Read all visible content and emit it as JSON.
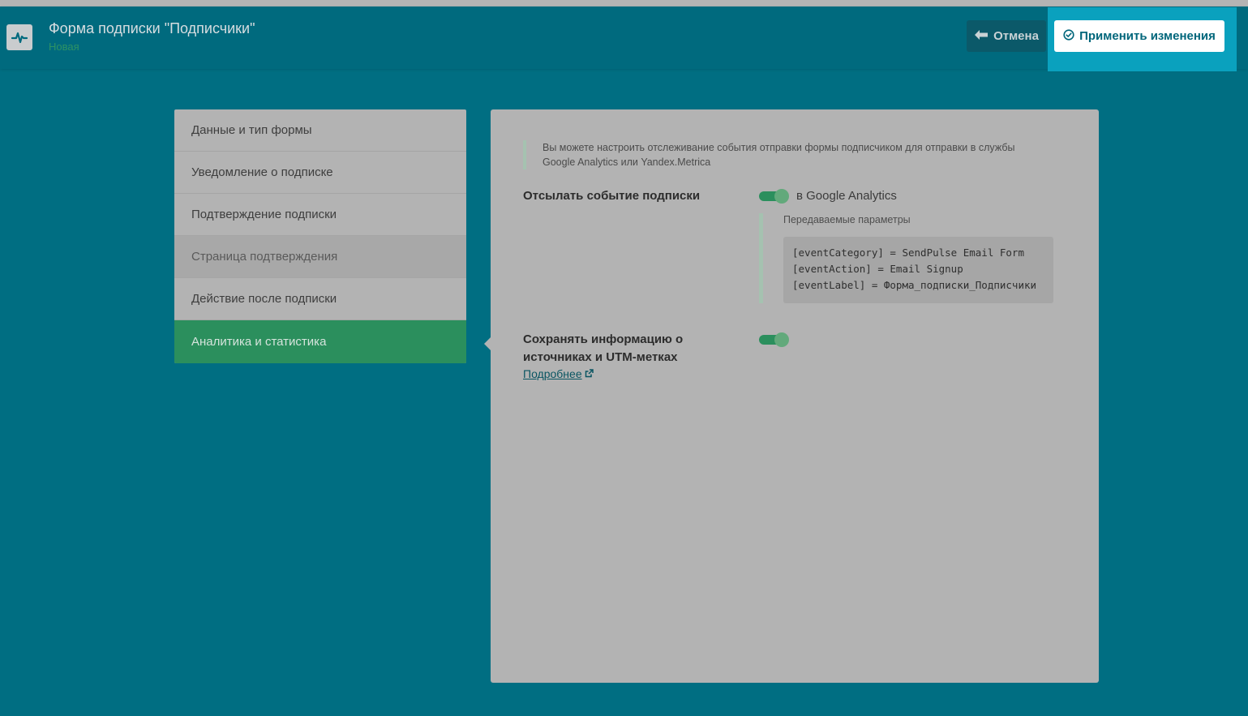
{
  "header": {
    "title": "Форма подписки \"Подписчики\"",
    "status": "Новая",
    "cancel_label": "Отмена",
    "apply_label": "Применить изменения",
    "logo_icon": "pulse-icon",
    "cancel_icon": "arrow-left-icon",
    "apply_icon": "check-circle-icon"
  },
  "sidebar": {
    "items": [
      {
        "label": "Данные и тип формы"
      },
      {
        "label": "Уведомление о подписке"
      },
      {
        "label": "Подтверждение подписки"
      },
      {
        "label": "Страница подтверждения"
      },
      {
        "label": "Действие после подписки"
      },
      {
        "label": "Аналитика и статистика"
      }
    ]
  },
  "panel": {
    "note": "Вы можете настроить отслеживание события отправки формы подписчиком для отправки в службы Google Analytics или Yandex.Metrica",
    "send_event": {
      "label": "Отсылать событие подписки",
      "toggle_text": "в Google Analytics",
      "enabled": true,
      "params_label": "Передаваемые параметры",
      "params": [
        "[eventCategory] = SendPulse Email Form",
        "[eventAction] = Email Signup",
        "[eventLabel] = Форма_подписки_Подписчики"
      ]
    },
    "utm": {
      "label_line1": "Сохранять информацию о",
      "label_line2": "источниках и UTM-метках",
      "enabled": true,
      "link_label": "Подробнее",
      "link_icon": "external-link-icon"
    }
  },
  "colors": {
    "background": "#006e82",
    "accent_green": "#2b8f5d",
    "apply_highlight": "#0aa1be",
    "panel": "#b3b3b3"
  }
}
